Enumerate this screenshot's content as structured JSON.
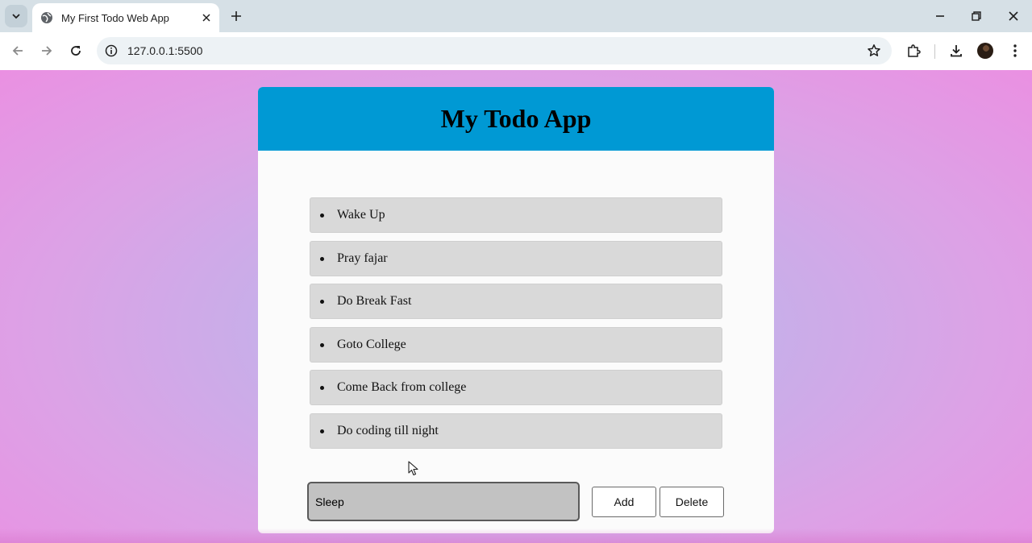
{
  "browser": {
    "tab": {
      "title": "My First Todo Web App",
      "favicon": "globe-icon",
      "close_icon": "close-icon"
    },
    "url": "127.0.0.1:5500",
    "icons": [
      "tab-search-icon",
      "new-tab-icon",
      "minimize-icon",
      "restore-icon",
      "window-close-icon",
      "back-icon",
      "forward-icon",
      "reload-icon",
      "site-info-icon",
      "bookmark-star-icon",
      "extensions-icon",
      "downloads-icon",
      "profile-avatar",
      "menu-icon"
    ]
  },
  "app": {
    "title": "My Todo App",
    "todos": [
      "Wake Up",
      "Pray fajar",
      "Do Break Fast",
      "Goto College",
      "Come Back from college",
      "Do coding till night"
    ],
    "input": {
      "value": "Sleep"
    },
    "buttons": {
      "add": "Add",
      "delete": "Delete"
    }
  },
  "colors": {
    "header": "#0099d4",
    "item_bg": "#d9d9d9",
    "input_bg": "#c2c2c2",
    "page_bg_center": "#bcb6ef",
    "page_bg_edge": "#ea90e2"
  }
}
